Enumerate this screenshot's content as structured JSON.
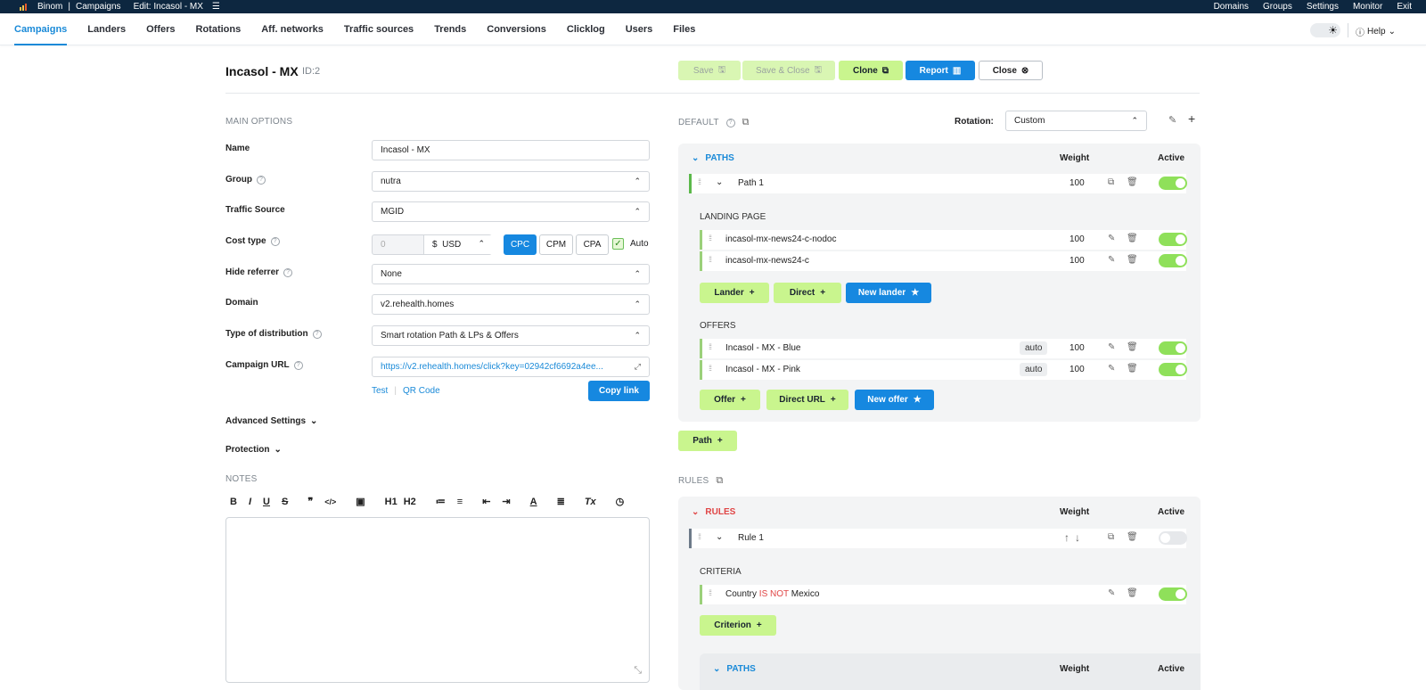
{
  "topbar": {
    "app": "Binom",
    "crumb1": "Campaigns",
    "crumb2": "Edit: Incasol - MX",
    "links": [
      "Domains",
      "Groups",
      "Settings",
      "Monitor",
      "Exit"
    ]
  },
  "nav": {
    "tabs": [
      "Campaigns",
      "Landers",
      "Offers",
      "Rotations",
      "Aff. networks",
      "Traffic sources",
      "Trends",
      "Conversions",
      "Clicklog",
      "Users",
      "Files"
    ],
    "active_tab": "Campaigns",
    "help": "Help"
  },
  "header": {
    "title": "Incasol - MX",
    "id": "ID:2",
    "save": "Save",
    "save_close": "Save & Close",
    "clone": "Clone",
    "report": "Report",
    "close": "Close"
  },
  "main_options": {
    "section": "MAIN OPTIONS",
    "name_label": "Name",
    "name_value": "Incasol - MX",
    "group_label": "Group",
    "group_value": "nutra",
    "ts_label": "Traffic Source",
    "ts_value": "MGID",
    "cost_label": "Cost type",
    "cost_value": "0",
    "currency_symbol": "$",
    "currency": "USD",
    "cost_modes": [
      "CPC",
      "CPM",
      "CPA"
    ],
    "cost_mode_selected": "CPC",
    "auto": "Auto",
    "hide_label": "Hide referrer",
    "hide_value": "None",
    "domain_label": "Domain",
    "domain_value": "v2.rehealth.homes",
    "dist_label": "Type of distribution",
    "dist_value": "Smart rotation Path & LPs & Offers",
    "url_label": "Campaign URL",
    "url_value": "https://v2.rehealth.homes/click?key=02942cf6692a4ee...",
    "test": "Test",
    "qr": "QR Code",
    "copy": "Copy link",
    "advanced": "Advanced Settings",
    "protection": "Protection",
    "notes": "NOTES"
  },
  "editor_tools": [
    "B",
    "I",
    "U",
    "S",
    "❞",
    "</>",
    "▣",
    "H1",
    "H2",
    "≔",
    "≡",
    "⇤",
    "⇥",
    "A",
    "≣",
    "Tx",
    "◷"
  ],
  "default_section": {
    "label": "DEFAULT",
    "rotation_label": "Rotation:",
    "rotation_value": "Custom",
    "paths_label": "PATHS",
    "weight_col": "Weight",
    "active_col": "Active",
    "path1": {
      "name": "Path 1",
      "weight": "100"
    },
    "landing_label": "LANDING PAGE",
    "landers": [
      {
        "name": "incasol-mx-news24-c-nodoc",
        "weight": "100"
      },
      {
        "name": "incasol-mx-news24-c",
        "weight": "100"
      }
    ],
    "lander_btn": "Lander",
    "direct_btn": "Direct",
    "new_lander_btn": "New lander",
    "offers_label": "OFFERS",
    "offers": [
      {
        "name": "Incasol - MX - Blue",
        "tag": "auto",
        "weight": "100"
      },
      {
        "name": "Incasol - MX - Pink",
        "tag": "auto",
        "weight": "100"
      }
    ],
    "offer_btn": "Offer",
    "direct_url_btn": "Direct URL",
    "new_offer_btn": "New offer",
    "path_btn": "Path"
  },
  "rules_section": {
    "label": "RULES",
    "rules_label": "RULES",
    "weight_col": "Weight",
    "active_col": "Active",
    "rule1": "Rule 1",
    "criteria_label": "CRITERIA",
    "criterion_pre": "Country",
    "criterion_op": "IS NOT",
    "criterion_val": "Mexico",
    "criterion_btn": "Criterion",
    "paths_label": "PATHS",
    "weight_col2": "Weight",
    "active_col2": "Active"
  },
  "colors": {
    "accent": "#1688e0",
    "green": "#c9f58e",
    "toggle_on": "#8fe05a",
    "red": "#e04545"
  }
}
